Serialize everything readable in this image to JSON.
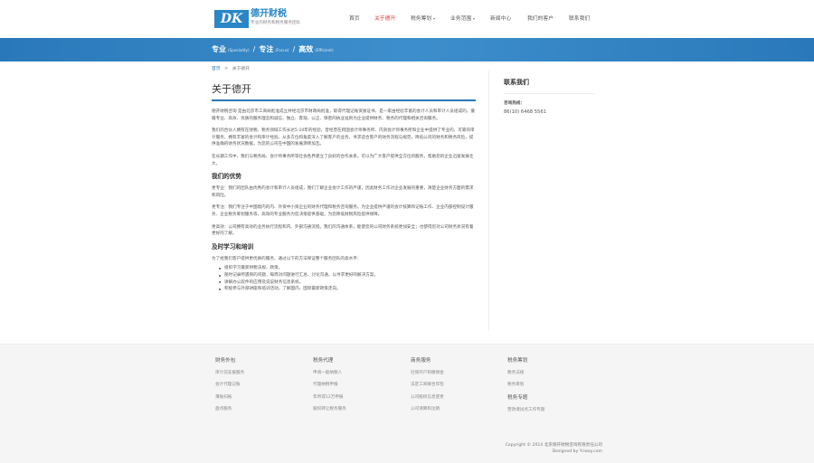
{
  "header": {
    "logo_text": "DK",
    "brand_name": "德开财税",
    "brand_sub": "专业的财务和税务服务团队",
    "nav": [
      {
        "label": "首页",
        "active": false,
        "dropdown": false
      },
      {
        "label": "关于德开",
        "active": true,
        "dropdown": false
      },
      {
        "label": "税务筹划",
        "active": false,
        "dropdown": true
      },
      {
        "label": "业务范围",
        "active": false,
        "dropdown": true
      },
      {
        "label": "新闻中心",
        "active": false,
        "dropdown": false
      },
      {
        "label": "我们的客户",
        "active": false,
        "dropdown": false
      },
      {
        "label": "联系我们",
        "active": false,
        "dropdown": false
      }
    ]
  },
  "banner": {
    "w1": "专业",
    "w1_en": "(Speciality)",
    "w2": "专注",
    "w2_en": "(Focus)",
    "w3": "高效",
    "w3_en": "(Efficient)",
    "sep": "/"
  },
  "breadcrumb": {
    "home": "首页",
    "sep": ">",
    "current": "关于德开"
  },
  "main": {
    "title": "关于德开",
    "p1": "德开财税咨询 是由北京市工商局批准成立并经北京市财政局批准，取得代理记账资质证书，是一家由经验丰富的会计人员和审计人员组成的，遵循专业、高效、优质的服务理念和诚信、独立、客观、公正、保密的执业准则为企业提供财务、税务的代理和相关咨询服务。",
    "p2": "我们的合伙人拥有在财税、税务领域工作长达5-10年的经验，曾经曾在跨国会计师事务所、内资会计师事务所和企业中提供了专业的、可靠的审计服务，拥有丰富的会计和审计经验。从多方位和角度深入了解客户的业务，寻求适合客户的财务流程与规范，降低公司的财务和税务风险，提供准确的财务状况数据，为您的公司在中国的发展添砖加瓦。",
    "p3": "在长期工作中，我们与税务局、会计师事务所等社会各界建立了良好的合作关系，可以为广大客户提供全方位的服务，帮助您的企业迅速发展壮大。",
    "h_adv": "我们的优势",
    "adv1": "更专业：我们的团队由优秀的会计和审计人员组成，我们了解企业会计工作的严谨，因此财务工作对企业发展的重要，清楚企业财务方面的需求和风险。",
    "adv2": "更专注：我们专注于中国境内的内、外资中小资企业的财务代理和税务咨询服务。为企业提供严谨的会计核算和记账工作、企业内部控制设计服务、企业税务筹划服务等，高效的专业服务为您决策提供基础，为您降低财税风险提供保障。",
    "adv3": "更高效：公司拥有高效的业务执行流程和内、外部沟通流程。我们的沟通体系，能使您的公司财务系统更加安全；也使得您对公司财务状况有着更好的了解。",
    "h_train": "及时学习和培训",
    "train_intro": "为了给我们客户提供更优质的服务，通过以下的方法保证整个服务团队的高水平：",
    "train_items": [
      "组织学习最新财税法规、政策。",
      "随时记录所遇到的问题，每周对问题进行汇总、讨论沟通，以寻求更好的解决方案。",
      "讲解办公软件的应用及说说财务信息系统。",
      "积极参与外部讲座和培训活动，了解国内、国际最新政策走向。"
    ]
  },
  "sidebar": {
    "title": "联系我们",
    "label": "咨询热线：",
    "phone": "86(10) 6468 5561"
  },
  "footer": {
    "columns": [
      {
        "title": "财务外包",
        "items": [
          "审计前支援服务",
          "会计代理记账",
          "薄账扫账",
          "盘点服务"
        ]
      },
      {
        "title": "税务代理",
        "items": [
          "申请一般纳税人",
          "代理纳税申报",
          "年所得12万申报",
          "股权转让税务服务"
        ]
      },
      {
        "title": "商务服务",
        "items": [
          "社保开户和缴保金",
          "法定工商联合年检",
          "公司股权信息变更",
          "公司清算和注销"
        ]
      },
      {
        "title": "税务筹划",
        "items": [
          "税务法规",
          "税务筹划"
        ],
        "title2": "税务专题",
        "items2": [
          "营改增试点工作专题"
        ]
      }
    ],
    "copyright": "Copyright © 2014 北京德开财税咨询有限责任公司",
    "designed": "Designed by Ycway.com"
  }
}
